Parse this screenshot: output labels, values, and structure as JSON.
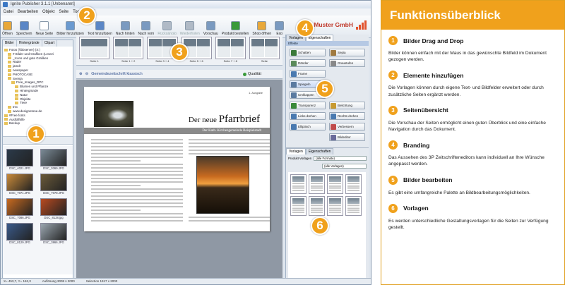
{
  "app": {
    "title": "Ignite Publisher 3.1.1 [Unbenannt]",
    "menu": [
      "Datei",
      "Bearbeiten",
      "Objekt",
      "Seite",
      "Tools",
      "Ansi"
    ],
    "toolbar": [
      {
        "label": "Öffnen",
        "color": "#e8a83a",
        "enabled": true
      },
      {
        "label": "Speichern",
        "color": "#5b87c6",
        "enabled": true
      },
      {
        "label": "Neue Seite",
        "color": "#ffffff",
        "enabled": true
      },
      {
        "label": "Bilder hinzufügen",
        "color": "#6a9ad0",
        "enabled": true
      },
      {
        "label": "Text hinzufügen",
        "color": "#5b87c6",
        "enabled": true
      },
      {
        "label": "Nach hinten",
        "color": "#7a9ac0",
        "enabled": true
      },
      {
        "label": "Nach vorn",
        "color": "#7a9ac0",
        "enabled": true
      },
      {
        "label": "Rückgängig",
        "color": "#b0bac6",
        "enabled": false
      },
      {
        "label": "Wiederholen",
        "color": "#b0bac6",
        "enabled": false
      },
      {
        "label": "Vorschau",
        "color": "#7a9ac0",
        "enabled": true
      },
      {
        "label": "Produkt bestellen",
        "color": "#3a9a3a",
        "enabled": true
      },
      {
        "label": "Shop öffnen",
        "color": "#e8a83a",
        "enabled": true
      },
      {
        "label": "Exp",
        "color": "#7a9ac0",
        "enabled": true
      }
    ],
    "brand": "Muster GmbH",
    "brand_color": "#c0392b",
    "left_tabs": [
      "Bilder",
      "Hintergründe",
      "Clipart"
    ],
    "tree": [
      {
        "label": "Fotos (\\\\bbserver) (X:)",
        "indent": 0
      },
      {
        "label": "# Bilder und Grafiken (Lesezi",
        "indent": 1
      },
      {
        "label": "_Icons und gute Grafiken",
        "indent": 1
      },
      {
        "label": "Räder",
        "indent": 1
      },
      {
        "label": "jamdr",
        "indent": 1
      },
      {
        "label": "newspaper",
        "indent": 1
      },
      {
        "label": "PHOTOCASE",
        "indent": 1
      },
      {
        "label": "Svenja",
        "indent": 1
      },
      {
        "label": "Free_Images_DPC",
        "indent": 2
      },
      {
        "label": "Blumen und Pflanze",
        "indent": 3
      },
      {
        "label": "Hintergründe",
        "indent": 3
      },
      {
        "label": "Natur",
        "indent": 3
      },
      {
        "label": "Objekte",
        "indent": 3
      },
      {
        "label": "Tiere",
        "indent": 3
      },
      {
        "label": "tmc",
        "indent": 1
      },
      {
        "label": "www.designetone.de",
        "indent": 1
      },
      {
        "label": "#Free fonts",
        "indent": 0
      },
      {
        "label": "Ausfüllhilfe",
        "indent": 0
      },
      {
        "label": "Backup",
        "indent": 0
      }
    ],
    "thumbnails": [
      {
        "name": "DSC_4021.JPG",
        "bg": "#2b3a4a"
      },
      {
        "name": "DSC_0369.JPG",
        "bg": "#7a8a96"
      },
      {
        "name": "DSC_7071.JPG",
        "bg": "#c88a3a"
      },
      {
        "name": "DSC_7078.JPG",
        "bg": "#6a5a3a"
      },
      {
        "name": "DSC_7086.JPG",
        "bg": "#c86a20"
      },
      {
        "name": "DSC_8128.jpg",
        "bg": "#b84a20"
      },
      {
        "name": "DSC_8129.JPG",
        "bg": "#3a5a8a"
      },
      {
        "name": "DSC_3866.JPG",
        "bg": "#9aa6b0"
      }
    ],
    "pages": [
      "Seite 1",
      "Seite 1 + 2",
      "Seite 3 + 4",
      "Seite 5 + 6",
      "Seite 7 + 8",
      "Seite"
    ],
    "canvas_toolbar": {
      "layout": "Gemeindezeitschrift klassisch",
      "quality": "Qualität"
    },
    "document": {
      "edition": "1. Ausgabe",
      "title_a": "Der neue",
      "title_b": "Pfarrbrief",
      "subtitle": "Der Kath. Kirchengemeinde Beispielstadt"
    },
    "right_tabs": [
      "Vorlagen",
      "Eigenschaften"
    ],
    "effects_title": "Effekte",
    "effects": [
      {
        "label": "Schatten",
        "color": "#3a7a3a"
      },
      {
        "label": "Sepia",
        "color": "#a07a40"
      },
      {
        "label": "Ränder",
        "color": "#5a8a5a"
      },
      {
        "label": "Graustufen",
        "color": "#888888"
      },
      {
        "label": "Frame",
        "color": "#4a7ab0"
      },
      {
        "label": "",
        "color": ""
      },
      {
        "label": "Spiegeln",
        "color": "#5a7aa0",
        "selected": true
      },
      {
        "label": "",
        "color": ""
      },
      {
        "label": "Umklappen",
        "color": "#5a7aa0"
      },
      {
        "label": "",
        "color": ""
      },
      {
        "label": "Transparenz",
        "color": "#3a8a3a"
      },
      {
        "label": "Belichtung",
        "color": "#c89a30"
      },
      {
        "label": "Links drehen",
        "color": "#4a7ab0"
      },
      {
        "label": "Rechts drehen",
        "color": "#4a7ab0"
      },
      {
        "label": "Elliptisch",
        "color": "#4a7ab0"
      },
      {
        "label": "Verbessern",
        "color": "#c04a4a"
      },
      {
        "label": "",
        "color": ""
      },
      {
        "label": "Bildeditor",
        "color": "#6a6a9a"
      }
    ],
    "vorlagen_tabs": [
      "Vorlagen",
      "Eigenschaften"
    ],
    "vorlagen_row1": {
      "label": "Produkt-Vorlagen",
      "value": "(alle Formate)"
    },
    "vorlagen_row2": {
      "value": "(alle Vorlagen)"
    },
    "status": [
      "X= 453,7, Y= 162,3",
      "Auflösung 3008 x 2000",
      "Selection 1917 x 2000"
    ]
  },
  "badges": [
    "1",
    "2",
    "3",
    "4",
    "5",
    "6"
  ],
  "panel": {
    "title": "Funktionsüberblick",
    "accent": "#f0a11c",
    "sections": [
      {
        "num": "1",
        "heading": "Bilder Drag and Drop",
        "text": "Bilder können einfach mit der Maus in das gewünschte Bildfeld im Dokument gezogen werden."
      },
      {
        "num": "2",
        "heading": "Elemente hinzufügen",
        "text": "Die Vorlagen können durch eigene Text- und Bildfelder erweitert oder durch zusätzliche Seiten ergänzt werden."
      },
      {
        "num": "3",
        "heading": "Seitenübersicht",
        "text": "Die Vorschau der Seiten ermöglicht einen guten Überblick und eine einfache Navigation durch das Dokument."
      },
      {
        "num": "4",
        "heading": "Branding",
        "text": "Das Aussehen des 3P Zeitschrifteneditors kann individuell an Ihre Wünsche angepasst werden."
      },
      {
        "num": "5",
        "heading": "Bilder bearbeiten",
        "text": "Es gibt eine umfangreiche Palette an Bildbearbeitungsmöglichkeiten."
      },
      {
        "num": "6",
        "heading": "Vorlagen",
        "text": "Es werden unterschiedliche Gestaltungsvorlagen für die Seiten zur Verfügung gestellt."
      }
    ]
  }
}
